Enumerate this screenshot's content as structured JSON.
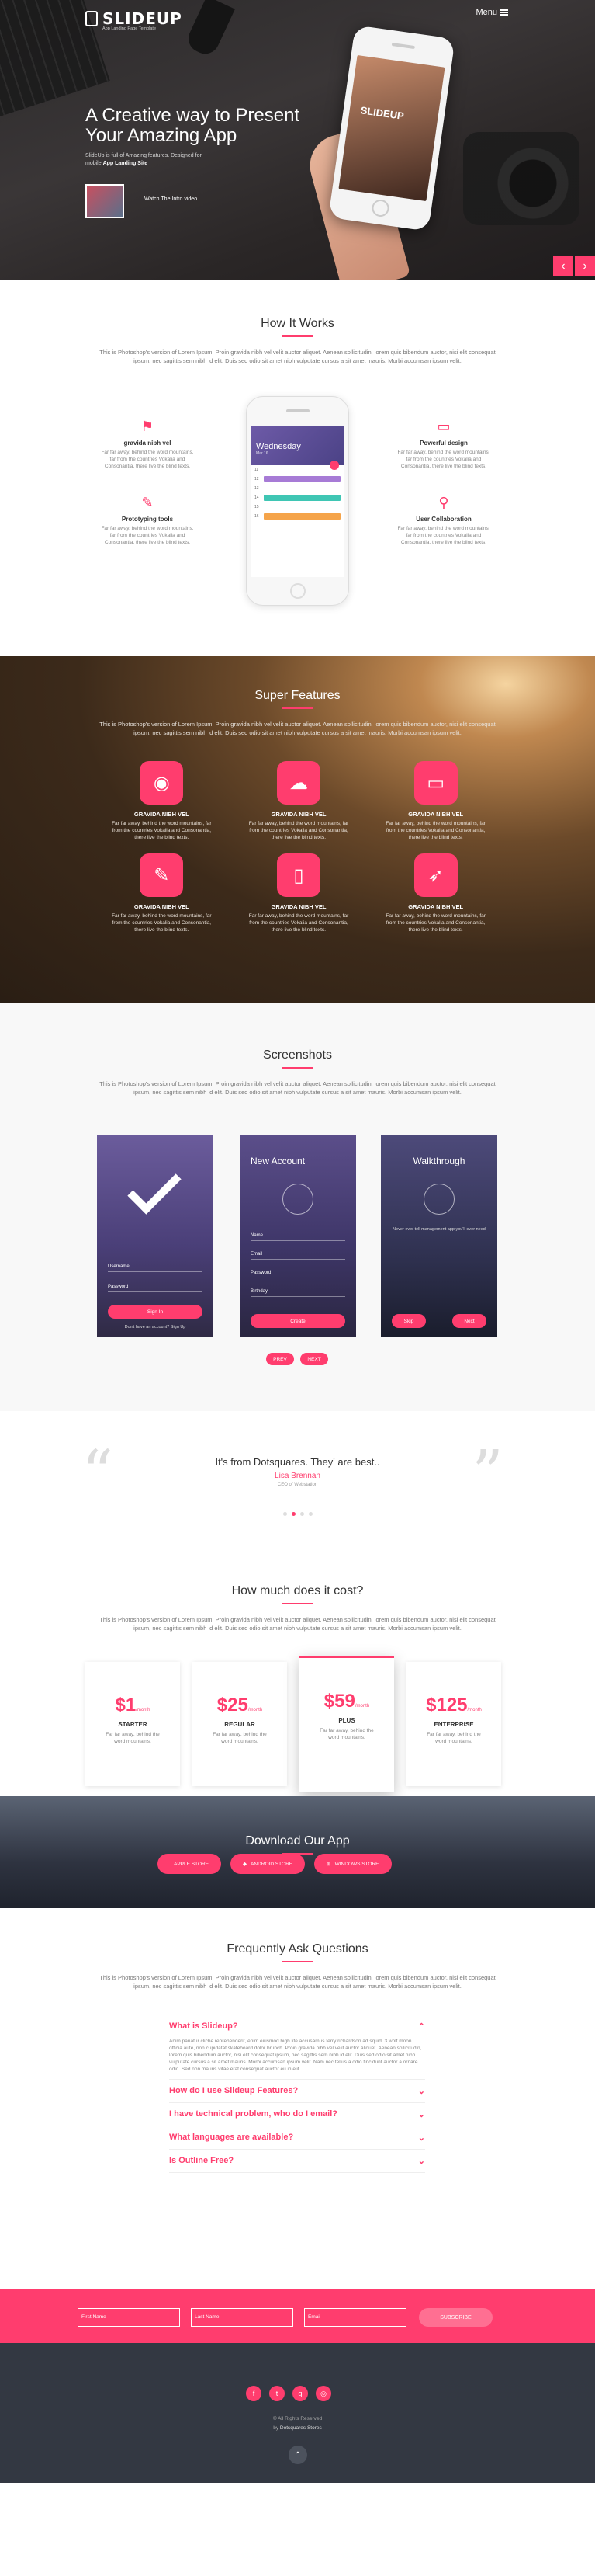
{
  "colors": {
    "accent": "#ff3d6e",
    "footer_bg": "#333842",
    "hero_bg": "#2c2a2b"
  },
  "header": {
    "logo_text": "SLIDEUP",
    "logo_sub": "App Landing Page Template",
    "menu_label": "Menu",
    "hero_title": "A Creative way to Present Your Amazing App",
    "hero_desc": "SlideUp is full of Amazing features. Designed for mobile",
    "hero_desc_bold": "App Landing Site",
    "video_label": "Watch The Intro video",
    "phone_logo": "SLIDEUP",
    "prev_icon": "chevron-left-icon",
    "next_icon": "chevron-right-icon"
  },
  "how": {
    "title": "How It Works",
    "intro": "This is Photoshop's version of Lorem Ipsum. Proin gravida nibh vel velit auctor aliquet. Aenean sollicitudin, lorem quis bibendum auctor, nisi elit consequat ipsum, nec sagittis sem nibh id elit. Duis sed odio sit amet nibh vulputate cursus a sit amet mauris. Morbi accumsan ipsum velit.",
    "app": {
      "day": "Wednesday",
      "date": "Mar 16",
      "rows": [
        "11",
        "12",
        "13",
        "14",
        "15",
        "16"
      ]
    },
    "features": [
      {
        "icon": "flag-icon",
        "title": "gravida nibh vel",
        "desc": "Far far away, behind the word mountains, far from the countries Vokalia and Consonantia, there live the blind texts."
      },
      {
        "icon": "monitor-icon",
        "title": "Powerful design",
        "desc": "Far far away, behind the word mountains, far from the countries Vokalia and Consonantia, there live the blind texts."
      },
      {
        "icon": "pencil-icon",
        "title": "Prototyping tools",
        "desc": "Far far away, behind the word mountains, far from the countries Vokalia and Consonantia, there live the blind texts."
      },
      {
        "icon": "search-icon",
        "title": "User Collaboration",
        "desc": "Far far away, behind the word mountains, far from the countries Vokalia and Consonantia, there live the blind texts."
      }
    ]
  },
  "super": {
    "title": "Super Features",
    "intro": "This is Photoshop's version of Lorem Ipsum. Proin gravida nibh vel velit auctor aliquet. Aenean sollicitudin, lorem quis bibendum auctor, nisi elit consequat ipsum, nec sagittis sem nibh id elit. Duis sed odio sit amet nibh vulputate cursus a sit amet mauris. Morbi accumsan ipsum velit.",
    "items": [
      {
        "icon": "eye-icon",
        "glyph": "◉",
        "title": "GRAVIDA NIBH VEL",
        "desc": "Far far away, behind the word mountains, far from the countries Vokalia and Consonantia, there live the blind texts."
      },
      {
        "icon": "cloud-icon",
        "glyph": "☁",
        "title": "GRAVIDA NIBH VEL",
        "desc": "Far far away, behind the word mountains, far from the countries Vokalia and Consonantia, there live the blind texts."
      },
      {
        "icon": "laptop-icon",
        "glyph": "▭",
        "title": "GRAVIDA NIBH VEL",
        "desc": "Far far away, behind the word mountains, far from the countries Vokalia and Consonantia, there live the blind texts."
      },
      {
        "icon": "pencil-icon",
        "glyph": "✎",
        "title": "GRAVIDA NIBH VEL",
        "desc": "Far far away, behind the word mountains, far from the countries Vokalia and Consonantia, there live the blind texts."
      },
      {
        "icon": "mobile-icon",
        "glyph": "▯",
        "title": "GRAVIDA NIBH VEL",
        "desc": "Far far away, behind the word mountains, far from the countries Vokalia and Consonantia, there live the blind texts."
      },
      {
        "icon": "rocket-icon",
        "glyph": "➶",
        "title": "GRAVIDA NIBH VEL",
        "desc": "Far far away, behind the word mountains, far from the countries Vokalia and Consonantia, there live the blind texts."
      }
    ]
  },
  "shots": {
    "title": "Screenshots",
    "intro": "This is Photoshop's version of Lorem Ipsum. Proin gravida nibh vel velit auctor aliquet. Aenean sollicitudin, lorem quis bibendum auctor, nisi elit consequat ipsum, nec sagittis sem nibh id elit. Duis sed odio sit amet nibh vulputate cursus a sit amet mauris. Morbi accumsan ipsum velit.",
    "login": {
      "username": "Username",
      "password": "Password",
      "button": "Sign In",
      "footer": "Don't have an account? Sign Up"
    },
    "account": {
      "title": "New Account",
      "fields": [
        "Name",
        "Email",
        "Password",
        "Birthday"
      ],
      "button": "Create"
    },
    "walk": {
      "title": "Walkthrough",
      "text": "Never ever tell management app you'll ever need",
      "skip": "Skip",
      "next": "Next"
    },
    "prev_btn": "PREV",
    "next_btn": "NEXT"
  },
  "testimonial": {
    "text": "It's from Dotsquares. They' are best..",
    "name": "Lisa Brennan",
    "role": "CEO of Webstation"
  },
  "pricing": {
    "title": "How much does it cost?",
    "intro": "This is Photoshop's version of Lorem Ipsum. Proin gravida nibh vel velit auctor aliquet. Aenean sollicitudin, lorem quis bibendum auctor, nisi elit consequat ipsum, nec sagittis sem nibh id elit. Duis sed odio sit amet nibh vulputate cursus a sit amet mauris. Morbi accumsan ipsum velit.",
    "plans": [
      {
        "price": "$1",
        "unit": "/month",
        "name": "STARTER",
        "desc": "Far far away, behind the word mountains."
      },
      {
        "price": "$25",
        "unit": "/month",
        "name": "REGULAR",
        "desc": "Far far away, behind the word mountains."
      },
      {
        "price": "$59",
        "unit": "/month",
        "name": "PLUS",
        "desc": "Far far away, behind the word mountains."
      },
      {
        "price": "$125",
        "unit": "/month",
        "name": "ENTERPRISE",
        "desc": "Far far away, behind the word mountains."
      }
    ]
  },
  "download": {
    "title": "Download Our App",
    "buttons": [
      {
        "icon": "apple-icon",
        "label": "APPLE STORE"
      },
      {
        "icon": "android-icon",
        "label": "ANDROID STORE"
      },
      {
        "icon": "windows-icon",
        "label": "WINDOWS STORE"
      }
    ]
  },
  "faq": {
    "title": "Frequently Ask Questions",
    "intro": "This is Photoshop's version of Lorem Ipsum. Proin gravida nibh vel velit auctor aliquet. Aenean sollicitudin, lorem quis bibendum auctor, nisi elit consequat ipsum, nec sagittis sem nibh id elit. Duis sed odio sit amet nibh vulputate cursus a sit amet mauris. Morbi accumsan ipsum velit.",
    "items": [
      {
        "q": "What is Slideup?",
        "a": "Anim pariatur cliche reprehenderit, enim eiusmod high life accusamus terry richardson ad squid. 3 wolf moon officia aute, non cupidatat skateboard dolor brunch. Proin gravida nibh vel velit auctor aliquet. Aenean sollicitudin, lorem quis bibendum auctor, nisi elit consequat ipsum, nec sagittis sem nibh id elit. Duis sed odio sit amet nibh vulputate cursus a sit amet mauris. Morbi accumsan ipsum velit. Nam nec tellus a odio tincidunt auctor a ornare odio. Sed non mauris vitae erat consequat auctor eu in elit.",
        "open": true
      },
      {
        "q": "How do I use Slideup Features?",
        "a": "",
        "open": false
      },
      {
        "q": "I have technical problem, who do I email?",
        "a": "",
        "open": false
      },
      {
        "q": "What languages are available?",
        "a": "",
        "open": false
      },
      {
        "q": "Is Outline Free?",
        "a": "",
        "open": false
      }
    ]
  },
  "subscribe": {
    "first_name": "First Name",
    "last_name": "Last Name",
    "email": "Email",
    "button": "SUBSCRIBE"
  },
  "footer": {
    "socials": [
      "facebook-icon",
      "twitter-icon",
      "google-plus-icon",
      "dribbble-icon"
    ],
    "copyright": "© All Rights Reserved",
    "by": "by",
    "brand": "Dotsquares Stores",
    "top_icon": "arrow-up-icon"
  }
}
